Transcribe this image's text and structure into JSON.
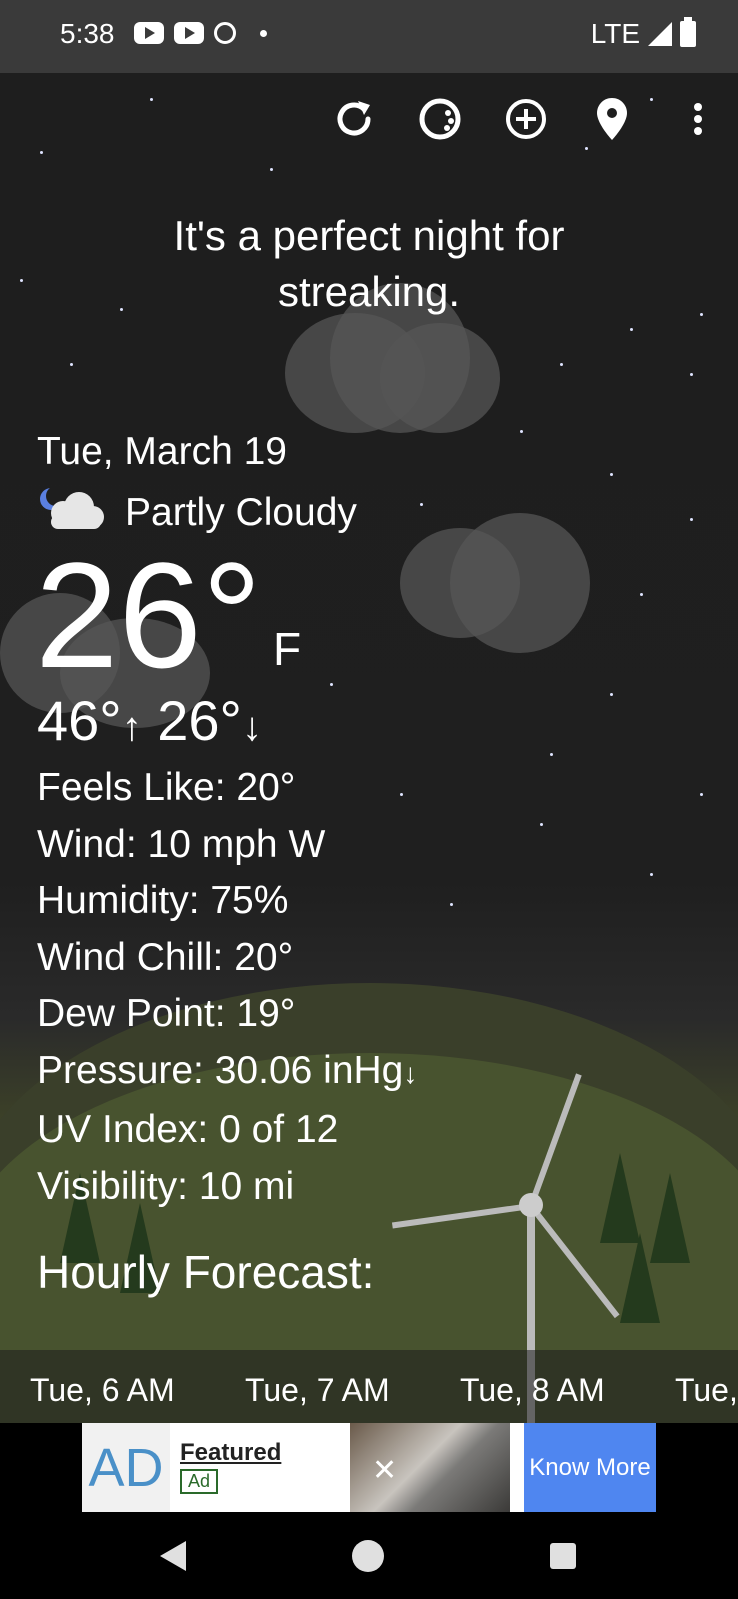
{
  "status_bar": {
    "time": "5:38",
    "network": "LTE",
    "icons": [
      "youtube-icon",
      "youtube-icon",
      "alarm-icon",
      "notification-dot"
    ]
  },
  "toolbar": {
    "icons": [
      "refresh-icon",
      "theme-icon",
      "add-location-icon",
      "location-pin-icon",
      "more-options-icon"
    ]
  },
  "headline": {
    "line1": "It's a perfect night for",
    "line2": "streaking."
  },
  "weather": {
    "date": "Tue, March 19",
    "condition": "Partly Cloudy",
    "condition_icon": "partly-cloudy-night-icon",
    "temperature": "26°",
    "unit": "F",
    "high": "46°",
    "high_arrow": "↑",
    "low": "26°",
    "low_arrow": "↓"
  },
  "details": {
    "feels_like": "Feels Like:  20°",
    "wind": "Wind:  10 mph W",
    "humidity": "Humidity:  75%",
    "wind_chill": "Wind Chill:  20°",
    "dew_point": "Dew Point:  19°",
    "pressure": "Pressure:  30.06 inHg",
    "pressure_arrow": "↓",
    "uv_index": "UV Index:  0 of 12",
    "visibility": "Visibility:  10 mi"
  },
  "hourly": {
    "title": "Hourly Forecast:",
    "hours": [
      "Tue, 6 AM",
      "Tue, 7 AM",
      "Tue, 8 AM",
      "Tue,"
    ]
  },
  "ad": {
    "logo": "AD",
    "featured": "Featured",
    "badge": "Ad",
    "close": "✕",
    "cta": "Know More"
  },
  "nav": {
    "icons": [
      "back-icon",
      "home-icon",
      "recents-icon"
    ]
  },
  "colors": {
    "background": "#1e1e1e",
    "ad_cta": "#4f86f0",
    "ad_logo": "#4a90c8"
  }
}
